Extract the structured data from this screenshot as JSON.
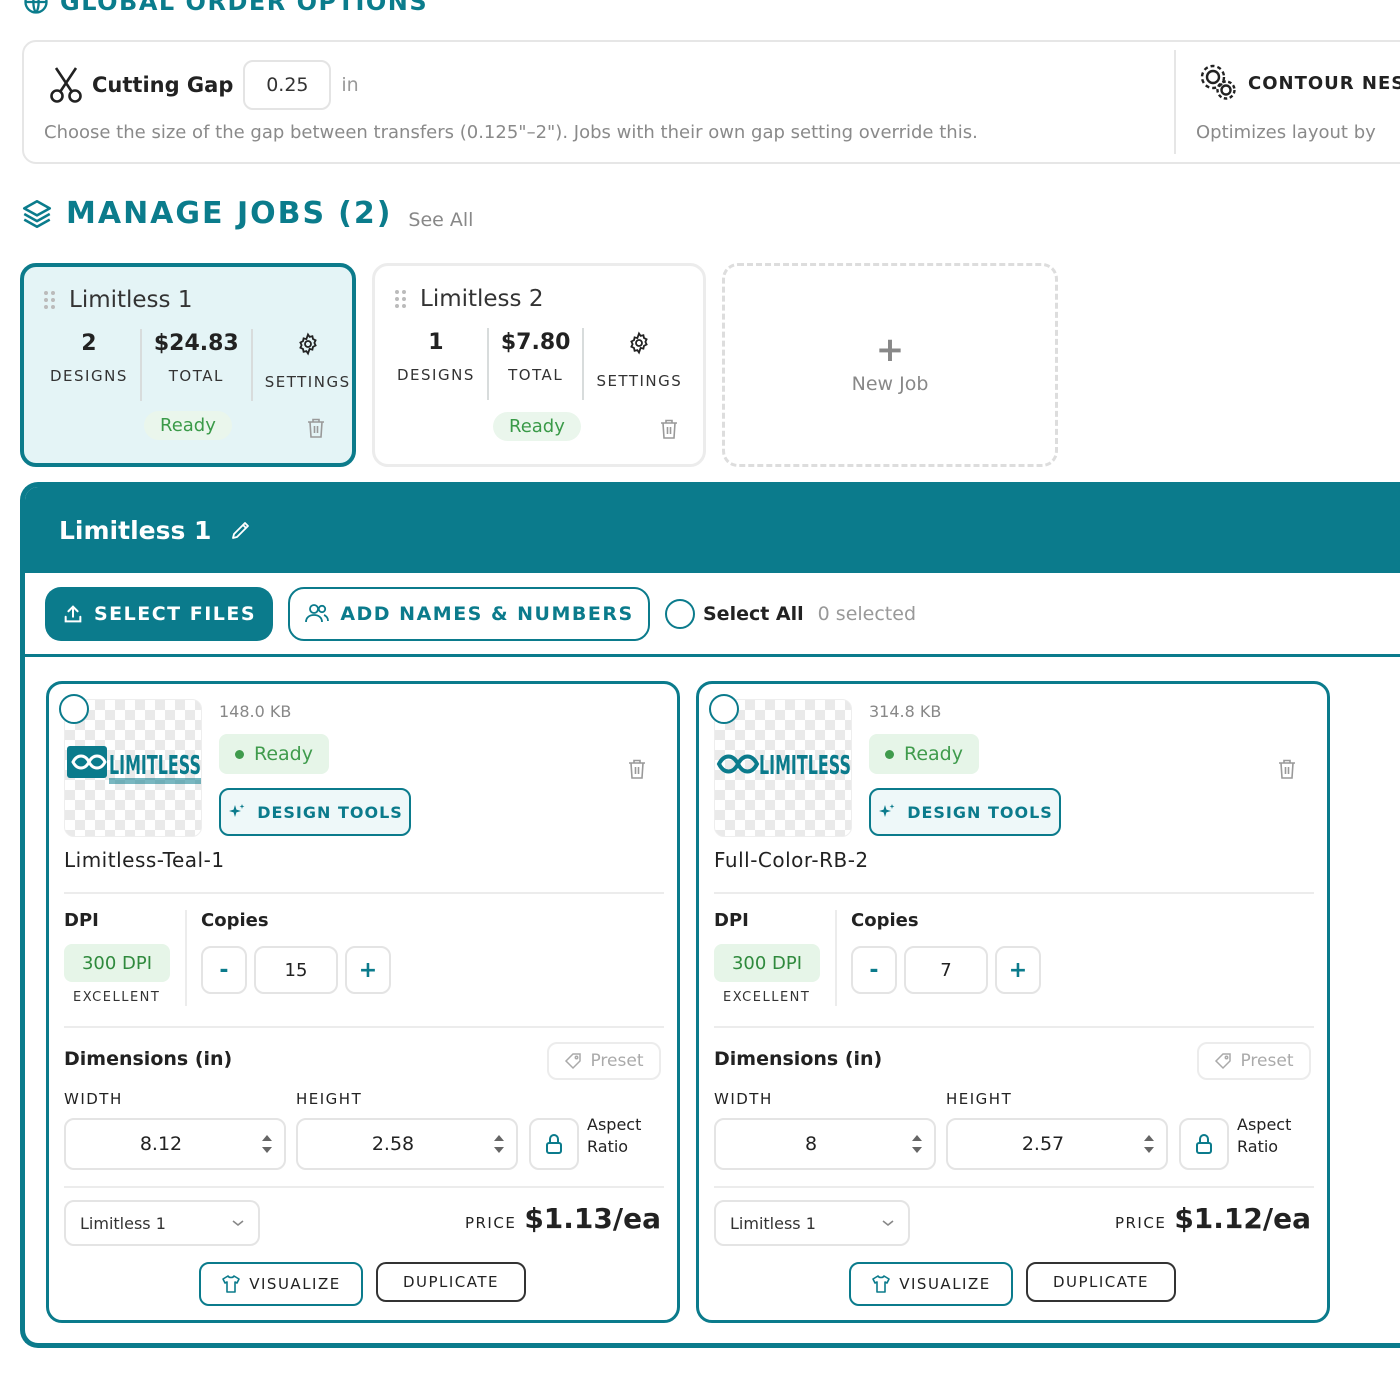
{
  "global_options": {
    "title": "GLOBAL ORDER OPTIONS",
    "cutting_gap": {
      "label": "Cutting Gap",
      "value": "0.25",
      "unit": "in",
      "description": "Choose the size of the gap between transfers (0.125\"–2\"). Jobs with their own gap setting override this."
    },
    "contour_nest": {
      "label": "CONTOUR NEST",
      "description": "Optimizes layout by"
    }
  },
  "manage_jobs": {
    "title": "MANAGE JOBS",
    "count": "(2)",
    "see_all": "See All",
    "jobs": [
      {
        "name": "Limitless 1",
        "designs": "2",
        "designs_label": "DESIGNS",
        "total": "$24.83",
        "total_label": "TOTAL",
        "settings_label": "SETTINGS",
        "status": "Ready",
        "active": true
      },
      {
        "name": "Limitless 2",
        "designs": "1",
        "designs_label": "DESIGNS",
        "total": "$7.80",
        "total_label": "TOTAL",
        "settings_label": "SETTINGS",
        "status": "Ready",
        "active": false
      }
    ],
    "new_job": {
      "plus": "+",
      "label": "New Job"
    }
  },
  "job_panel": {
    "name": "Limitless 1",
    "select_files": "SELECT FILES",
    "add_names": "ADD NAMES & NUMBERS",
    "select_all": "Select All",
    "selected_count": "0 selected",
    "designs": [
      {
        "file_size": "148.0 KB",
        "status": "Ready",
        "design_tools": "DESIGN TOOLS",
        "name": "Limitless-Teal-1",
        "dpi_label": "DPI",
        "dpi_value": "300 DPI",
        "dpi_quality": "EXCELLENT",
        "copies_label": "Copies",
        "copies_minus": "-",
        "copies": "15",
        "copies_plus": "+",
        "dimensions_label": "Dimensions (in)",
        "preset": "Preset",
        "width_label": "WIDTH",
        "width": "8.12",
        "height_label": "HEIGHT",
        "height": "2.58",
        "aspect_label_1": "Aspect",
        "aspect_label_2": "Ratio",
        "job_select": "Limitless 1",
        "price_label": "PRICE",
        "price": "$1.13/ea",
        "visualize": "VISUALIZE",
        "duplicate": "DUPLICATE"
      },
      {
        "file_size": "314.8 KB",
        "status": "Ready",
        "design_tools": "DESIGN TOOLS",
        "name": "Full-Color-RB-2",
        "dpi_label": "DPI",
        "dpi_value": "300 DPI",
        "dpi_quality": "EXCELLENT",
        "copies_label": "Copies",
        "copies_minus": "-",
        "copies": "7",
        "copies_plus": "+",
        "dimensions_label": "Dimensions (in)",
        "preset": "Preset",
        "width_label": "WIDTH",
        "width": "8",
        "height_label": "HEIGHT",
        "height": "2.57",
        "aspect_label_1": "Aspect",
        "aspect_label_2": "Ratio",
        "job_select": "Limitless 1",
        "price_label": "PRICE",
        "price": "$1.12/ea",
        "visualize": "VISUALIZE",
        "duplicate": "DUPLICATE"
      }
    ]
  },
  "logo_text": "LIMITLESS",
  "colors": {
    "primary": "#0b7b8c",
    "ready_bg": "#e6f5e8",
    "ready_text": "#3f9b4c"
  }
}
